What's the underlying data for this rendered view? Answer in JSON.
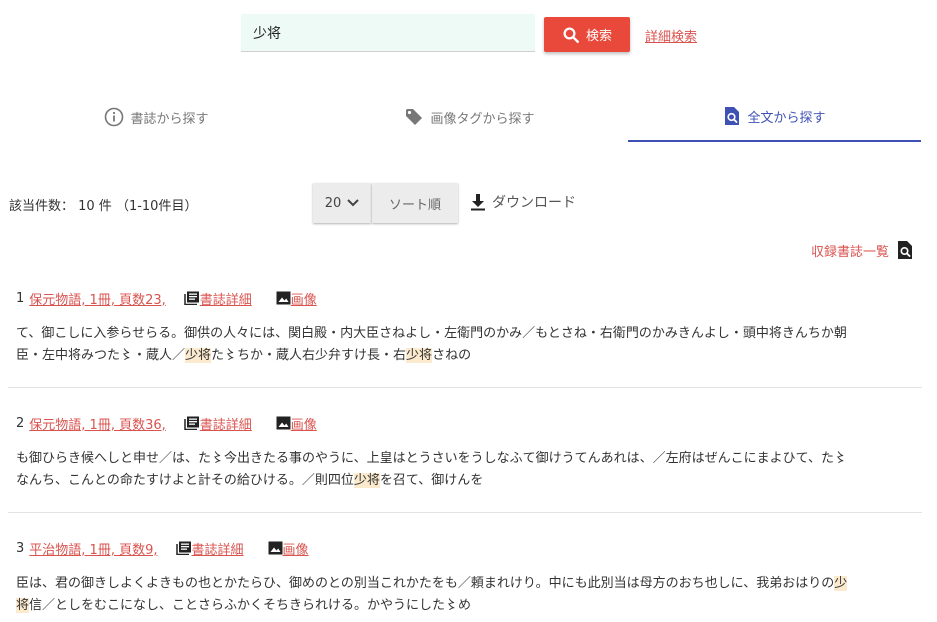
{
  "search": {
    "query": "少将",
    "button_label": "検索",
    "advanced_label": "詳細検索"
  },
  "tabs": [
    {
      "label": "書誌から探す",
      "icon": "info-icon"
    },
    {
      "label": "画像タグから探す",
      "icon": "tag-icon"
    },
    {
      "label": "全文から探す",
      "icon": "document-search-icon",
      "active": true
    }
  ],
  "results_bar": {
    "count_text": "該当件数： 10 件 （1-10件目）",
    "per_page": "20",
    "sort_label": "ソート順",
    "download_label": "ダウンロード",
    "collection_label": "収録書誌一覧"
  },
  "results": [
    {
      "num": "1",
      "title": "保元物語, 1冊, 頁数23,",
      "detail_label": "書誌詳細",
      "image_label": "画像",
      "line1": [
        {
          "t": "て、御こしに入参らせらる。御供の人々には、関白殿・内大臣さねよし・左衛門のかみ／もとさね・右衛門のかみきんよし・頭中将きんちか朝"
        }
      ],
      "line2": [
        {
          "t": "臣・左中将みつた〻・蔵人／"
        },
        {
          "t": "少将",
          "hl": true
        },
        {
          "t": "た〻ちか・蔵人右少弁すけ長・右"
        },
        {
          "t": "少将",
          "hl": true
        },
        {
          "t": "さねの"
        }
      ]
    },
    {
      "num": "2",
      "title": "保元物語, 1冊, 頁数36,",
      "detail_label": "書誌詳細",
      "image_label": "画像",
      "line1": [
        {
          "t": "も御ひらき候へしと申せ／は、た〻今出きたる事のやうに、上皇はとうさいをうしなふて御けうてんあれは、／左府はぜんこにまよひて、た〻"
        }
      ],
      "line2": [
        {
          "t": "なんち、こんとの命たすけよと計その給ひける。／則四位"
        },
        {
          "t": "少将",
          "hl": true
        },
        {
          "t": "を召て、御けんを"
        }
      ]
    },
    {
      "num": "3",
      "title": "平治物語, 1冊, 頁数9,",
      "detail_label": "書誌詳細",
      "image_label": "画像",
      "line1": [
        {
          "t": "臣は、君の御きしよくよきもの也とかたらひ、御めのとの別当これかたをも／頼まれけり。中にも此別当は母方のおち也しに、我弟おはりの"
        },
        {
          "t": "少",
          "hl": true
        }
      ],
      "line2": [
        {
          "t": "将",
          "hl": true
        },
        {
          "t": "信／としをむこになし、ことさらふかくそちきられける。かやうにした〻め"
        }
      ]
    }
  ]
}
